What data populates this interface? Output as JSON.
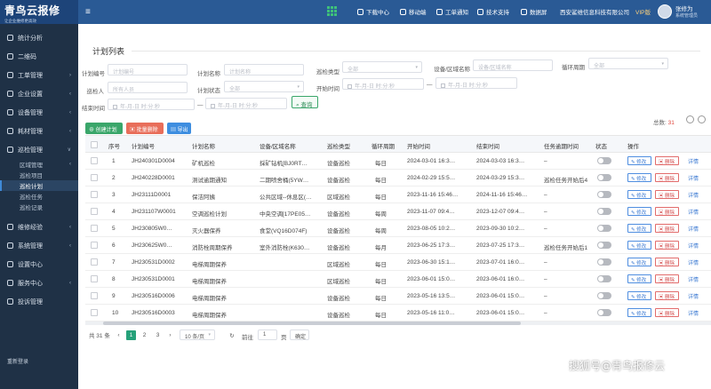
{
  "brand": {
    "title": "青鸟云报修",
    "slogan": "让企业维修更高效",
    "accent": "#2a5a95"
  },
  "topnav": [
    {
      "label": "下载中心",
      "icon": "download-icon"
    },
    {
      "label": "移动端",
      "icon": "mobile-icon"
    },
    {
      "label": "工单通知",
      "icon": "bell-icon"
    },
    {
      "label": "技术支持",
      "icon": "support-icon"
    },
    {
      "label": "数据屏",
      "icon": "screen-icon"
    }
  ],
  "company": "西安鲨维信息科技有限公司",
  "vip": "VIP版",
  "user": {
    "name": "张修为",
    "role": "系统管理员"
  },
  "sidebar": [
    {
      "label": "统计分析",
      "icon": "chart-icon"
    },
    {
      "label": "二维码",
      "icon": "qrcode-icon"
    },
    {
      "label": "工单管理",
      "icon": "ticket-icon",
      "arrow": "›"
    },
    {
      "label": "企业设置",
      "icon": "building-icon",
      "arrow": "‹"
    },
    {
      "label": "设备管理",
      "icon": "device-icon",
      "arrow": "‹"
    },
    {
      "label": "耗材管理",
      "icon": "box-icon",
      "arrow": "‹"
    },
    {
      "label": "巡检管理",
      "icon": "inspect-icon",
      "arrow": "∨"
    }
  ],
  "sidebar_sub": [
    {
      "label": "区域管理",
      "arrow": "‹"
    },
    {
      "label": "巡检项目"
    },
    {
      "label": "巡检计划",
      "active": true
    },
    {
      "label": "巡检任务"
    },
    {
      "label": "巡检记录"
    }
  ],
  "sidebar_rest": [
    {
      "label": "维修经验",
      "icon": "book-icon",
      "arrow": "‹"
    },
    {
      "label": "系统管理",
      "icon": "gear-icon",
      "arrow": "‹"
    },
    {
      "label": "设置中心",
      "icon": "settings-icon"
    },
    {
      "label": "服务中心",
      "icon": "service-icon",
      "arrow": "‹"
    },
    {
      "label": "投诉管理",
      "icon": "complaint-icon"
    }
  ],
  "sidebar_bottom": "重新登录",
  "page_title": "计划列表",
  "filters": {
    "plan_no": {
      "label": "计划编号",
      "placeholder": "计划编号"
    },
    "plan_name": {
      "label": "计划名称",
      "placeholder": "计划名称"
    },
    "type": {
      "label": "巡检类型",
      "value": "全部"
    },
    "device": {
      "label": "设备/区域名称",
      "placeholder": "设备/区域名称"
    },
    "cycle": {
      "label": "循环周期",
      "value": "全部"
    },
    "inspector": {
      "label": "巡检人",
      "placeholder": "所有人员"
    },
    "status": {
      "label": "计划状态",
      "value": "全部"
    },
    "start": {
      "label": "开始时间",
      "placeholder": "年-月-日 时:分:秒",
      "sep": "—"
    },
    "end": {
      "label": "结束时间",
      "placeholder": "年-月-日 时:分:秒",
      "sep": "—"
    },
    "query": "查询"
  },
  "actions": {
    "create": "创建计划",
    "batch_delete": "批量删除",
    "export": "导出"
  },
  "total": {
    "label": "总数:",
    "value": "31"
  },
  "columns": [
    "序号",
    "计划编号",
    "计划名称",
    "设备/区域名称",
    "巡检类型",
    "循环周期",
    "开始时间",
    "结束时间",
    "任务逾期时间",
    "状态",
    "操作"
  ],
  "rows": [
    {
      "no": "1",
      "code": "JH240301D0004",
      "name": "矿机巡检",
      "area": "採矿钻机[BJ0RT…",
      "type": "设备巡检",
      "cycle": "每日",
      "start": "2024-03-01 16:3…",
      "end": "2024-03-03 16:3…",
      "overdue": "–"
    },
    {
      "no": "2",
      "code": "JH240228D0001",
      "name": "测试逾期通知",
      "area": "二期喷舍桶(5YW…",
      "type": "设备巡检",
      "cycle": "每日",
      "start": "2024-02-29 15:5…",
      "end": "2024-03-29 15:3…",
      "overdue": "巡检任务开始后4"
    },
    {
      "no": "3",
      "code": "JH23111D0001",
      "name": "保洁阿姨",
      "area": "公共区域--休息区(…",
      "type": "区域巡检",
      "cycle": "每日",
      "start": "2023-11-16 15:46…",
      "end": "2024-11-16 15:46…",
      "overdue": "–"
    },
    {
      "no": "4",
      "code": "JH231107W0001",
      "name": "空调巡检计划",
      "area": "中央空调[17PE05…",
      "type": "设备巡检",
      "cycle": "每周",
      "start": "2023-11-07 09:4…",
      "end": "2023-12-07 09:4…",
      "overdue": "–"
    },
    {
      "no": "5",
      "code": "JH230805W0…",
      "name": "灭火器保养",
      "area": "食堂(VQ16D074F)",
      "type": "设备巡检",
      "cycle": "每周",
      "start": "2023-08-05 10:2…",
      "end": "2023-09-30 10:2…",
      "overdue": "–"
    },
    {
      "no": "6",
      "code": "JH230625W0…",
      "name": "消防栓周期保养",
      "area": "室外消防栓(K630…",
      "type": "设备巡检",
      "cycle": "每月",
      "start": "2023-06-25 17:3…",
      "end": "2023-07-25 17:3…",
      "overdue": "巡检任务开始后1"
    },
    {
      "no": "7",
      "code": "JH230531D0002",
      "name": "电梯周期保养",
      "area": "",
      "type": "区域巡检",
      "cycle": "每日",
      "start": "2023-06-30 15:1…",
      "end": "2023-07-01 16:0…",
      "overdue": "–"
    },
    {
      "no": "8",
      "code": "JH230531D0001",
      "name": "电梯周期保养",
      "area": "",
      "type": "区域巡检",
      "cycle": "每日",
      "start": "2023-06-01 15:0…",
      "end": "2023-06-01 16:0…",
      "overdue": "–"
    },
    {
      "no": "9",
      "code": "JH230516D0006",
      "name": "电梯周期保养",
      "area": "",
      "type": "设备巡检",
      "cycle": "每日",
      "start": "2023-05-16 13:5…",
      "end": "2023-06-01 15:0…",
      "overdue": "–"
    },
    {
      "no": "10",
      "code": "JH230516D0003",
      "name": "电梯周期保养",
      "area": "",
      "type": "设备巡检",
      "cycle": "每日",
      "start": "2023-05-16 11:0…",
      "end": "2023-06-01 15:0…",
      "overdue": "–"
    }
  ],
  "row_actions": {
    "edit": "修改",
    "delete": "删除",
    "detail": "详情"
  },
  "pager": {
    "total": "共 31 条",
    "pages": [
      "1",
      "2",
      "3"
    ],
    "size": "10 条/页",
    "goto": "前往",
    "page_input": "1",
    "unit": "页",
    "confirm": "确定"
  },
  "watermark": "搜狐号@青鸟报修云"
}
